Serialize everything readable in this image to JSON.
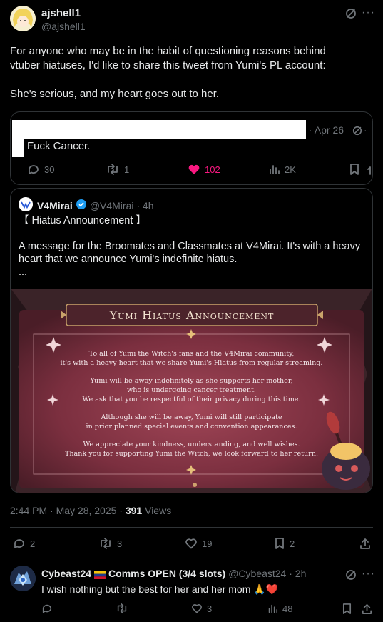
{
  "main_post": {
    "display_name": "ajshell1",
    "handle": "@ajshell1",
    "body_line1": "For anyone who may be in the habit of questioning reasons behind",
    "body_line2": "vtuber hiatuses, I'd like to share this tweet from Yumi's PL account:",
    "body_line3": "She's serious, and my heart goes out to her.",
    "timestamp": "2:44 PM · May 28, 2025 · ",
    "views_count": "391",
    "views_label": " Views",
    "actions": {
      "replies": "2",
      "reposts": "3",
      "likes": "19",
      "bookmarks": "2"
    }
  },
  "quoted_post": {
    "date": "· Apr 26",
    "text": "Fuck Cancer.",
    "actions": {
      "replies": "30",
      "reposts": "1",
      "likes": "102",
      "views": "2K"
    }
  },
  "embedded_post": {
    "display_name": "V4Mirai",
    "handle": "@V4Mirai · 4h",
    "title": "【 Hiatus Announcement 】",
    "body_line1": "A message for the Broomates and Classmates at V4Mirai. It's with a heavy",
    "body_line2": "heart that we announce Yumi's indefinite hiatus.",
    "ellipsis": "...",
    "image": {
      "header": "Yumi Hiatus Announcement",
      "lines": [
        "To all of Yumi the Witch's fans and the V4Mirai community,",
        "it's with a heavy heart that we share Yumi's Hiatus from regular streaming.",
        "",
        "Yumi will be away indefinitely as she supports her mother,",
        "who is undergoing cancer treatment.",
        "We ask that you be respectful of their privacy during this time.",
        "",
        "Although she will be away, Yumi will still participate",
        "in prior planned special events and convention appearances.",
        "",
        "We appreciate your kindness, understanding, and well wishes.",
        "Thank you for supporting Yumi the Witch, we look forward to her return."
      ]
    }
  },
  "reply": {
    "display_name": "Cybeast24",
    "name_suffix": " Comms OPEN (3/4 slots)",
    "handle": "@Cybeast24 · 2h",
    "text": "I wish nothing but the best for her and her mom ",
    "emoji": "🙏❤️",
    "actions": {
      "replies": "",
      "reposts": "",
      "likes": "3",
      "views": "48"
    }
  },
  "colors": {
    "background": "#000000",
    "text": "#e7e9ea",
    "muted": "#71767b",
    "border": "#2f3336",
    "like_active": "#f91880",
    "verified": "#1d9bf0",
    "poster_red": "#8e3a4a"
  }
}
